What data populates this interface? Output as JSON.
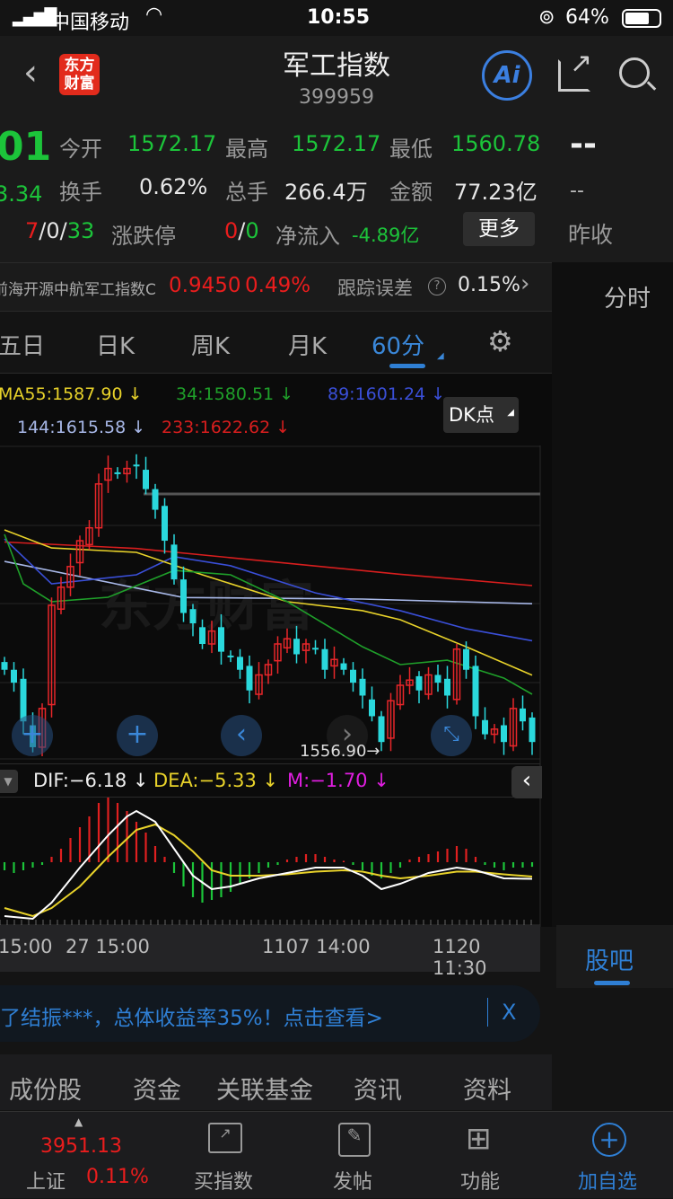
{
  "status_bar": {
    "carrier": "中国移动",
    "time": "10:55",
    "battery": "64%"
  },
  "header": {
    "title": "军工指数",
    "code": "399959",
    "logo_text": "东方财富",
    "ai_label": "Ai"
  },
  "quote": {
    "price_partial": "01",
    "change_partial": "3.34",
    "open_label": "今开",
    "open": "1572.17",
    "high_label": "最高",
    "high": "1572.17",
    "low_label": "最低",
    "low": "1560.78",
    "turnover_label": "换手",
    "turnover": "0.62%",
    "volume_label": "总手",
    "volume": "266.4万",
    "amount_label": "金额",
    "amount": "77.23亿",
    "up": "7",
    "flat": "0",
    "down": "33",
    "limit_label": "涨跌停",
    "limit_up": "0",
    "limit_down": "0",
    "netflow_label": "净流入",
    "netflow": "-4.89亿",
    "more_label": "更多",
    "right_top": "--",
    "right_mid": "--",
    "prev_close_label": "昨收"
  },
  "fund": {
    "name": "前海开源中航军工指数C",
    "nav": "0.9450",
    "change": "0.49%",
    "tracking_label": "跟踪误差",
    "tracking": "0.15%"
  },
  "side": {
    "intraday_label": "分时",
    "guba_label": "股吧"
  },
  "tabs": [
    {
      "label": "五日"
    },
    {
      "label": "日K"
    },
    {
      "label": "周K"
    },
    {
      "label": "月K"
    },
    {
      "label": "60分",
      "active": true
    }
  ],
  "ma_legend": {
    "ma55": "MA55:1587.90 ↓",
    "ma34": "34:1580.51 ↓",
    "ma89": "89:1601.24 ↓",
    "ma144": "144:1615.58 ↓",
    "ma233": "233:1622.62 ↓",
    "dk_label": "DK点"
  },
  "macd_legend": {
    "dif": "DIF:−6.18 ↓",
    "dea": "DEA:−5.33 ↓",
    "m": "M:−1.70 ↓"
  },
  "chart_data": {
    "type": "candlestick",
    "price_low_label": "1556.90→",
    "x_labels": [
      "15:00",
      "27 15:00",
      "1107 14:00",
      "1120 11:30"
    ],
    "closes": [
      1590,
      1585,
      1570,
      1560,
      1575,
      1615,
      1622,
      1630,
      1640,
      1645,
      1662,
      1668,
      1666,
      1668,
      1669,
      1660,
      1652,
      1640,
      1625,
      1612,
      1608,
      1600,
      1605,
      1597,
      1595,
      1590,
      1582,
      1588,
      1592,
      1600,
      1602,
      1596,
      1600,
      1598,
      1590,
      1594,
      1590,
      1585,
      1580,
      1572,
      1562,
      1578,
      1584,
      1586,
      1582,
      1588,
      1585,
      1580,
      1598,
      1590,
      1572,
      1565,
      1567,
      1562,
      1575,
      1570,
      1562
    ],
    "ma": [
      {
        "name": "233",
        "color": "#d81e1e",
        "points": [
          [
            0,
            1639.5
          ],
          [
            14,
            1637
          ],
          [
            28,
            1632
          ],
          [
            42,
            1627
          ],
          [
            56,
            1622.62
          ]
        ]
      },
      {
        "name": "144",
        "color": "#a8b8e8",
        "points": [
          [
            0,
            1632
          ],
          [
            19,
            1618
          ],
          [
            38,
            1617.4
          ],
          [
            56,
            1615.58
          ]
        ]
      },
      {
        "name": "89",
        "color": "#3a4fd8",
        "points": [
          [
            0,
            1640.7
          ],
          [
            5,
            1623.3
          ],
          [
            14,
            1626.8
          ],
          [
            18,
            1633.8
          ],
          [
            24,
            1630.3
          ],
          [
            33,
            1619.8
          ],
          [
            42,
            1612.9
          ],
          [
            49,
            1605.9
          ],
          [
            56,
            1601.24
          ]
        ]
      },
      {
        "name": "MA55",
        "color": "#e8d22a",
        "points": [
          [
            0,
            1644.2
          ],
          [
            5,
            1637.2
          ],
          [
            14,
            1635.5
          ],
          [
            21,
            1626.8
          ],
          [
            30,
            1616.4
          ],
          [
            38,
            1612.9
          ],
          [
            42,
            1609.4
          ],
          [
            49,
            1598.9
          ],
          [
            56,
            1587.9
          ]
        ]
      },
      {
        "name": "34",
        "color": "#1fa02a",
        "points": [
          [
            0,
            1642.5
          ],
          [
            2,
            1623.3
          ],
          [
            5,
            1616.4
          ],
          [
            11,
            1618.1
          ],
          [
            18,
            1628.5
          ],
          [
            24,
            1626.8
          ],
          [
            30,
            1616.4
          ],
          [
            38,
            1598.9
          ],
          [
            42,
            1592
          ],
          [
            47,
            1593.7
          ],
          [
            53,
            1586.8
          ],
          [
            56,
            1580.51
          ]
        ]
      }
    ],
    "macd_hist": [
      -3,
      -4,
      -3,
      -2,
      -1,
      2,
      5,
      9,
      13,
      17,
      22,
      24,
      22,
      19,
      15,
      11,
      6,
      2,
      -4,
      -9,
      -13,
      -15,
      -14,
      -13,
      -11,
      -8,
      -6,
      -4,
      -2,
      -1,
      1,
      2,
      3,
      3,
      2,
      1,
      0.5,
      -1,
      -3,
      -5,
      -6,
      -4,
      -2,
      1,
      2,
      3,
      4,
      5,
      6,
      5,
      2,
      -1,
      -2,
      -3,
      -2,
      -2,
      -1.7
    ],
    "dif": [
      [
        0,
        -20
      ],
      [
        3,
        -21
      ],
      [
        5,
        -15
      ],
      [
        8,
        -2
      ],
      [
        11,
        10
      ],
      [
        13,
        17
      ],
      [
        14,
        19
      ],
      [
        16,
        15
      ],
      [
        18,
        5
      ],
      [
        20,
        -5
      ],
      [
        22,
        -10
      ],
      [
        24,
        -9
      ],
      [
        27,
        -6
      ],
      [
        30,
        -4
      ],
      [
        33,
        -2
      ],
      [
        36,
        -2
      ],
      [
        38,
        -5
      ],
      [
        40,
        -10
      ],
      [
        42,
        -8
      ],
      [
        45,
        -4
      ],
      [
        48,
        -2
      ],
      [
        50,
        -3
      ],
      [
        53,
        -6
      ],
      [
        56,
        -6.18
      ]
    ],
    "dea": [
      [
        0,
        -17
      ],
      [
        3,
        -20
      ],
      [
        5,
        -17
      ],
      [
        8,
        -9
      ],
      [
        11,
        2
      ],
      [
        14,
        12
      ],
      [
        16,
        14
      ],
      [
        18,
        10
      ],
      [
        20,
        4
      ],
      [
        22,
        -3
      ],
      [
        24,
        -5
      ],
      [
        27,
        -5
      ],
      [
        30,
        -4.5
      ],
      [
        33,
        -3.5
      ],
      [
        36,
        -3
      ],
      [
        38,
        -3.5
      ],
      [
        40,
        -5
      ],
      [
        42,
        -6
      ],
      [
        45,
        -5
      ],
      [
        48,
        -3.5
      ],
      [
        50,
        -3.5
      ],
      [
        53,
        -4.5
      ],
      [
        56,
        -5.33
      ]
    ],
    "colors": {
      "up": "#e8262a",
      "down": "#2ad8dc",
      "dif": "#ffffff",
      "dea": "#e8d22a"
    }
  },
  "ad": {
    "text": "了结振***，总体收益率35%！点击查看>",
    "close": "X"
  },
  "bottom_tabs": [
    {
      "label": "成份股"
    },
    {
      "label": "资金"
    },
    {
      "label": "关联基金"
    },
    {
      "label": "资讯"
    },
    {
      "label": "资料"
    }
  ],
  "toolbar": {
    "index_value": "3951.13",
    "index_name": "上证",
    "index_change": "0.11%",
    "buy_label": "买指数",
    "post_label": "发帖",
    "func_label": "功能",
    "add_label": "加自选"
  }
}
